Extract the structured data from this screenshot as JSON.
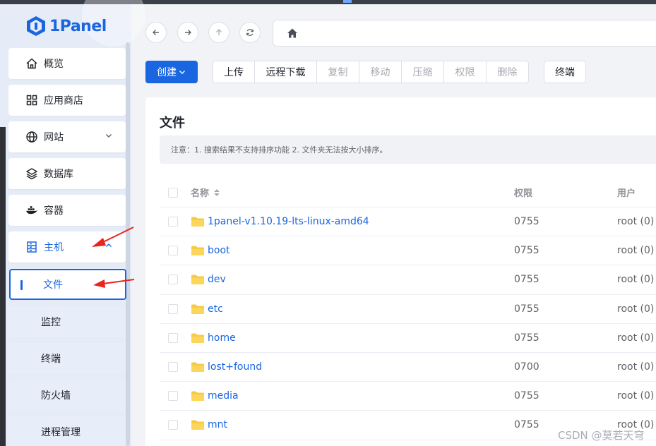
{
  "app": {
    "logo": "1Panel"
  },
  "sidebar": {
    "items": [
      {
        "label": "概览",
        "icon": "home-icon"
      },
      {
        "label": "应用商店",
        "icon": "grid-icon"
      },
      {
        "label": "网站",
        "icon": "globe-icon"
      },
      {
        "label": "数据库",
        "icon": "layers-icon"
      },
      {
        "label": "容器",
        "icon": "docker-icon"
      },
      {
        "label": "主机",
        "icon": "server-icon"
      }
    ],
    "sub_items": [
      {
        "label": "文件"
      },
      {
        "label": "监控"
      },
      {
        "label": "终端"
      },
      {
        "label": "防火墙"
      },
      {
        "label": "进程管理"
      }
    ]
  },
  "toolbar": {
    "create_label": "创建",
    "group": [
      {
        "label": "上传",
        "disabled": false
      },
      {
        "label": "远程下载",
        "disabled": false
      },
      {
        "label": "复制",
        "disabled": true
      },
      {
        "label": "移动",
        "disabled": true
      },
      {
        "label": "压缩",
        "disabled": true
      },
      {
        "label": "权限",
        "disabled": true
      },
      {
        "label": "删除",
        "disabled": true
      }
    ],
    "terminal_label": "终端"
  },
  "files": {
    "title": "文件",
    "notice": "注意：1. 搜索结果不支持排序功能 2. 文件夹无法按大小排序。",
    "columns": {
      "name": "名称",
      "perm": "权限",
      "user": "用户"
    },
    "rows": [
      {
        "name": "1panel-v1.10.19-lts-linux-amd64",
        "perm": "0755",
        "user": "root (0)"
      },
      {
        "name": "boot",
        "perm": "0755",
        "user": "root (0)"
      },
      {
        "name": "dev",
        "perm": "0755",
        "user": "root (0)"
      },
      {
        "name": "etc",
        "perm": "0755",
        "user": "root (0)"
      },
      {
        "name": "home",
        "perm": "0755",
        "user": "root (0)"
      },
      {
        "name": "lost+found",
        "perm": "0700",
        "user": "root (0)"
      },
      {
        "name": "media",
        "perm": "0755",
        "user": "root (0)"
      },
      {
        "name": "mnt",
        "perm": "0755",
        "user": "root (0)"
      }
    ]
  },
  "watermark": "CSDN @莫若天穹",
  "colors": {
    "accent": "#1a66e0",
    "annotation": "#e8251f",
    "sidebar_bg": "#e6ecf7"
  }
}
